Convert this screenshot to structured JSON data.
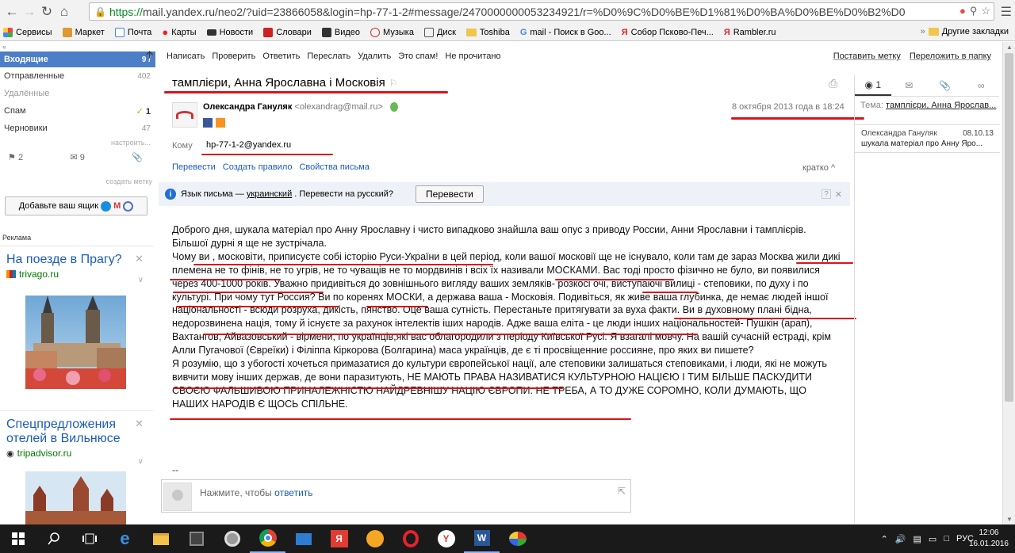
{
  "browser": {
    "url_https": "https://",
    "url_rest": "mail.yandex.ru/neo2/?uid=23866058&login=hp-77-1-2#message/2470000000053234921/r=%D0%9C%D0%BE%D1%81%D0%BA%D0%BE%D0%B2%D0",
    "bookmarks": [
      "Сервисы",
      "Маркет",
      "Почта",
      "Карты",
      "Новости",
      "Словари",
      "Видео",
      "Музыка",
      "Диск",
      "Toshiba",
      "mail - Поиск в Goo...",
      "Собор Псково-Печ...",
      "Rambler.ru"
    ],
    "other_bookmarks": "Другие закладки"
  },
  "folders": {
    "inbox": "Входящие",
    "inbox_count": "9 /",
    "sent": "Отправленные",
    "sent_count": "402",
    "deleted": "Удалённые",
    "spam": "Спам",
    "spam_count": "1",
    "drafts": "Черновики",
    "drafts_count": "47",
    "tune": "настроить...",
    "flag_count": "2",
    "mail_count": "9",
    "add_tag": "создать метку",
    "add_mailbox": "Добавьте ваш ящик"
  },
  "ads": {
    "label": "Реклама",
    "ad1_title": "На поезде в Прагу?",
    "ad1_domain": "trivago.ru",
    "ad2_title": "Спецпредложения отелей в Вильнюсе",
    "ad2_domain": "tripadvisor.ru"
  },
  "toolbar": {
    "compose": "Написать",
    "check": "Проверить",
    "reply": "Ответить",
    "forward": "Переслать",
    "delete": "Удалить",
    "spam": "Это спам!",
    "unread": "Не прочитано",
    "label": "Поставить метку",
    "move": "Переложить в папку"
  },
  "message": {
    "subject": "тамплієри, Анна Ярославна і Московія",
    "sender_name": "Олександра Гануляк",
    "sender_email": "<olexandrag@mail.ru>",
    "date": "8 октября 2013 года в 18:24",
    "to_label": "Кому",
    "to_value": "hp-77-1-2@yandex.ru",
    "action_forward": "Перевести",
    "action_rule": "Создать правило",
    "action_props": "Свойства письма",
    "short": "кратко ^",
    "translate_prefix": "Язык письма —",
    "translate_lang": "украинский",
    "translate_suffix": ". Перевести на русский?",
    "translate_button": "Перевести",
    "body_p1": "Доброго дня, шукала матеріал про Анну Ярославну і чисто випадково знайшла ваш опус з приводу России, Анни Ярославни і тамплієрів. Більшої дурні я ще не зустрічала.",
    "body_p2": "Чому ви , московіти, приписуєте собі історію Руси-України в цей період, коли вашої московії ще не існувало, коли там де зараз Москва жили дикі племена не то фінів, не то угрів, не то чуващів не то мордвинів і всіх їх називали МОСКАМИ. Вас тоді просто фізично не було, ви появилися через 400-1000 років. Уважно придивіться до зовнішнього вигляду ваших земляків- розкосі очі, виступаючі вилиці - степовики, по духу і по культурі. При чому тут Россия? Ви по коренях МОСКИ, а держава ваша - Московія. Подивіться, як живе ваша глубинка, де немає людей іншої національності - всюди розруха, дикість, пянство. Оце ваша сутність.  Перестаньте притягувати за вуха факти. Ви в духовному плані бідна, недорозвинена нація,  тому й існуєте за рахунок інтелектів іших народів. Адже ваша еліта - це люди інших національностей- Пушкін (арап), Вахтангов, Айвазовський - вірмени, по українців,які вас облагородили з періоду Київської Русі. Я взагалі мовчу.   На вашій сучасній естраді, крім Алли Пугачової (Євреїки) і Філіппа Кіркорова (Болгарина) маса українців, де є ті просвіщенние россияне, про яких ви пишете?",
    "body_p3": "Я розумію, що з убогості хочеться примазатися до культури європейської нації, але степовики залишаться степовиками, і люди, які не можуть вивчити мову інших держав, де вони паразитують, НЕ МАЮТЬ ПРАВА НАЗИВАТИСЯ КУЛЬТУРНОЮ НАЦІЄЮ І ТИМ БІЛЬШЕ ПАСКУДИТИ СВОЄЮ ФАЛЬШИВОЮ ПРИНАЛЕЖНІСТЮ НАЙДРЕВНІШУ НАЦІЮ ЄВРОПИ. НЕ ТРЕБА, А ТО ДУЖЕ СОРОМНО, КОЛИ ДУМАЮТЬ, ЩО НАШИХ НАРОДІВ Є ЩОСЬ СПІЛЬНЕ.",
    "signature": "--",
    "reply_prompt": "Нажмите, чтобы",
    "reply_link": "ответить"
  },
  "thread": {
    "count": "1",
    "tema_label": "Тема:",
    "tema_value": "тамплієри, Анна Ярослав...",
    "item_name": "Олександра Гануляк",
    "item_date": "08.10.13",
    "item_text": "шукала матеріал про Анну Яро..."
  },
  "taskbar": {
    "lang": "РУС",
    "time": "12:06",
    "date": "16.01.2016"
  }
}
